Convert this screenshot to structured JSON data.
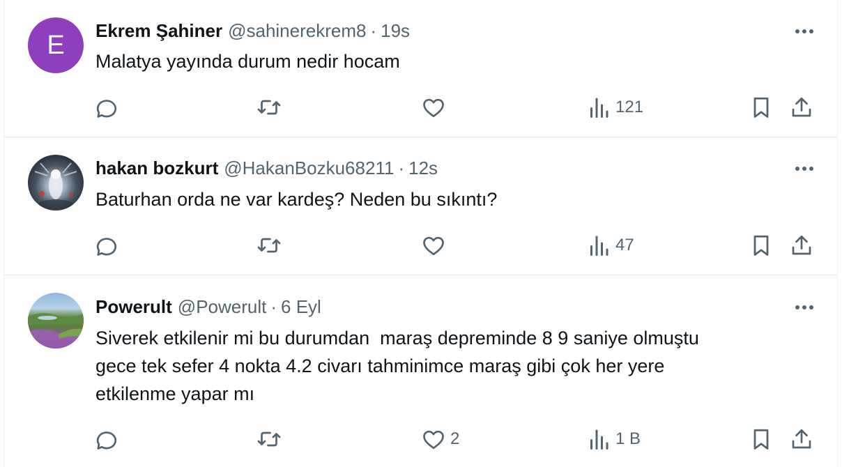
{
  "tweets": [
    {
      "name": "Ekrem Şahiner",
      "handle": "@sahinerekrem8",
      "separator": "·",
      "time": "19s",
      "avatar": {
        "type": "letter",
        "letter": "E",
        "color": "#8e3fbd"
      },
      "text": "Malatya yayında durum nedir hocam",
      "likes": "",
      "views": "121"
    },
    {
      "name": "hakan bozkurt",
      "handle": "@HakanBozku68211",
      "separator": "·",
      "time": "12s",
      "avatar": {
        "type": "image",
        "description": "ghostly-figure"
      },
      "text": "Baturhan orda ne var kardeş? Neden bu sıkıntı?",
      "likes": "",
      "views": "47"
    },
    {
      "name": "Powerult",
      "handle": "@Powerult",
      "separator": "·",
      "time": "6 Eyl",
      "avatar": {
        "type": "image",
        "description": "landscape-heather-hills"
      },
      "text_lines": [
        "Siverek etkilenir mi bu durumdan  maraş depreminde 8 9 saniye olmuştu",
        "gece tek sefer 4 nokta 4.2 civarı tahminimce maraş gibi çok her yere",
        "etkilenme yapar mı"
      ],
      "likes": "2",
      "views": "1 B"
    }
  ],
  "colors": {
    "text_primary": "#0f1419",
    "text_secondary": "#536471",
    "divider": "#e3e7e9"
  },
  "icons": [
    "reply-icon",
    "retweet-icon",
    "like-icon",
    "views-icon",
    "bookmark-icon",
    "share-icon",
    "more-icon"
  ]
}
